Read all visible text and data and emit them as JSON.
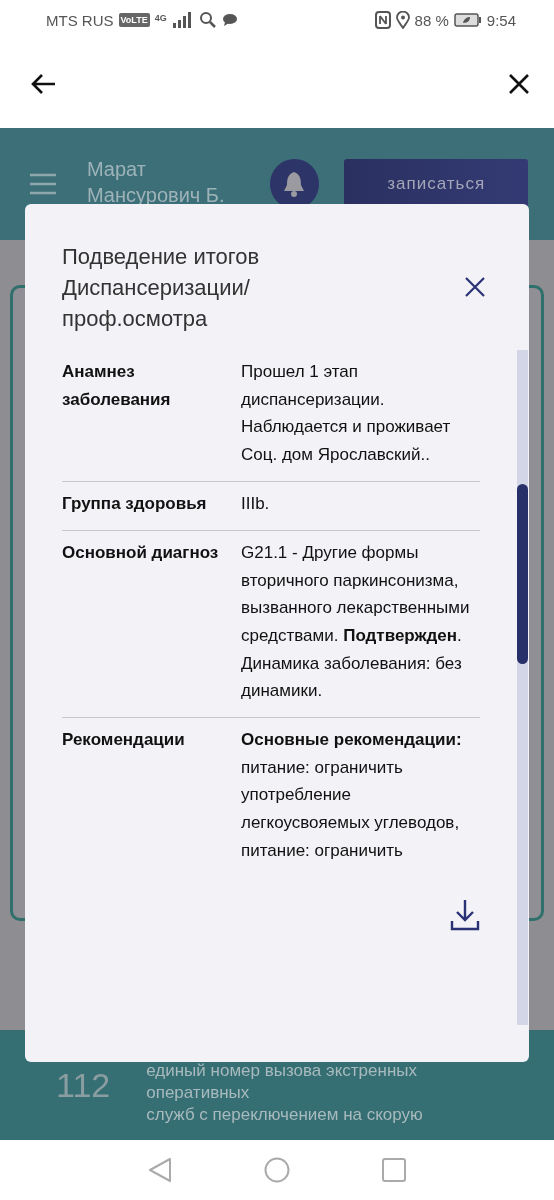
{
  "status_bar": {
    "carrier": "MTS RUS",
    "volte": "VoLTE",
    "network": "4G",
    "battery": "88 %",
    "time": "9:54"
  },
  "header": {
    "user_name_lines": [
      "Марат",
      "Мансурович Б."
    ],
    "signup_button": "записаться"
  },
  "footer": {
    "number": "112",
    "description_lines": [
      "единый номер вызова экстренных",
      "оперативных",
      "служб с переключением на скорую"
    ]
  },
  "dialog": {
    "title_lines": [
      "Подведение итогов",
      "Диспансеризации/",
      "проф.осмотра"
    ],
    "rows": [
      {
        "label": "Анамнез заболевания",
        "value": "Прошел 1 этап диспансеризации. Наблюдается и проживает Соц. дом Ярославский.."
      },
      {
        "label": "Группа здоровья",
        "value": "IIIb."
      },
      {
        "label": "Основной диагноз",
        "value": "G21.1 - Другие формы вторичного паркинсонизма, вызванного лекарственными средствами. **Подтвержден**. Динамика заболевания: без динамики."
      },
      {
        "label": "Рекомендации",
        "value": "**Основные рекомендации:** питание: ограничить употребление легкоусвояемых углеводов, питание: ограничить"
      }
    ]
  }
}
